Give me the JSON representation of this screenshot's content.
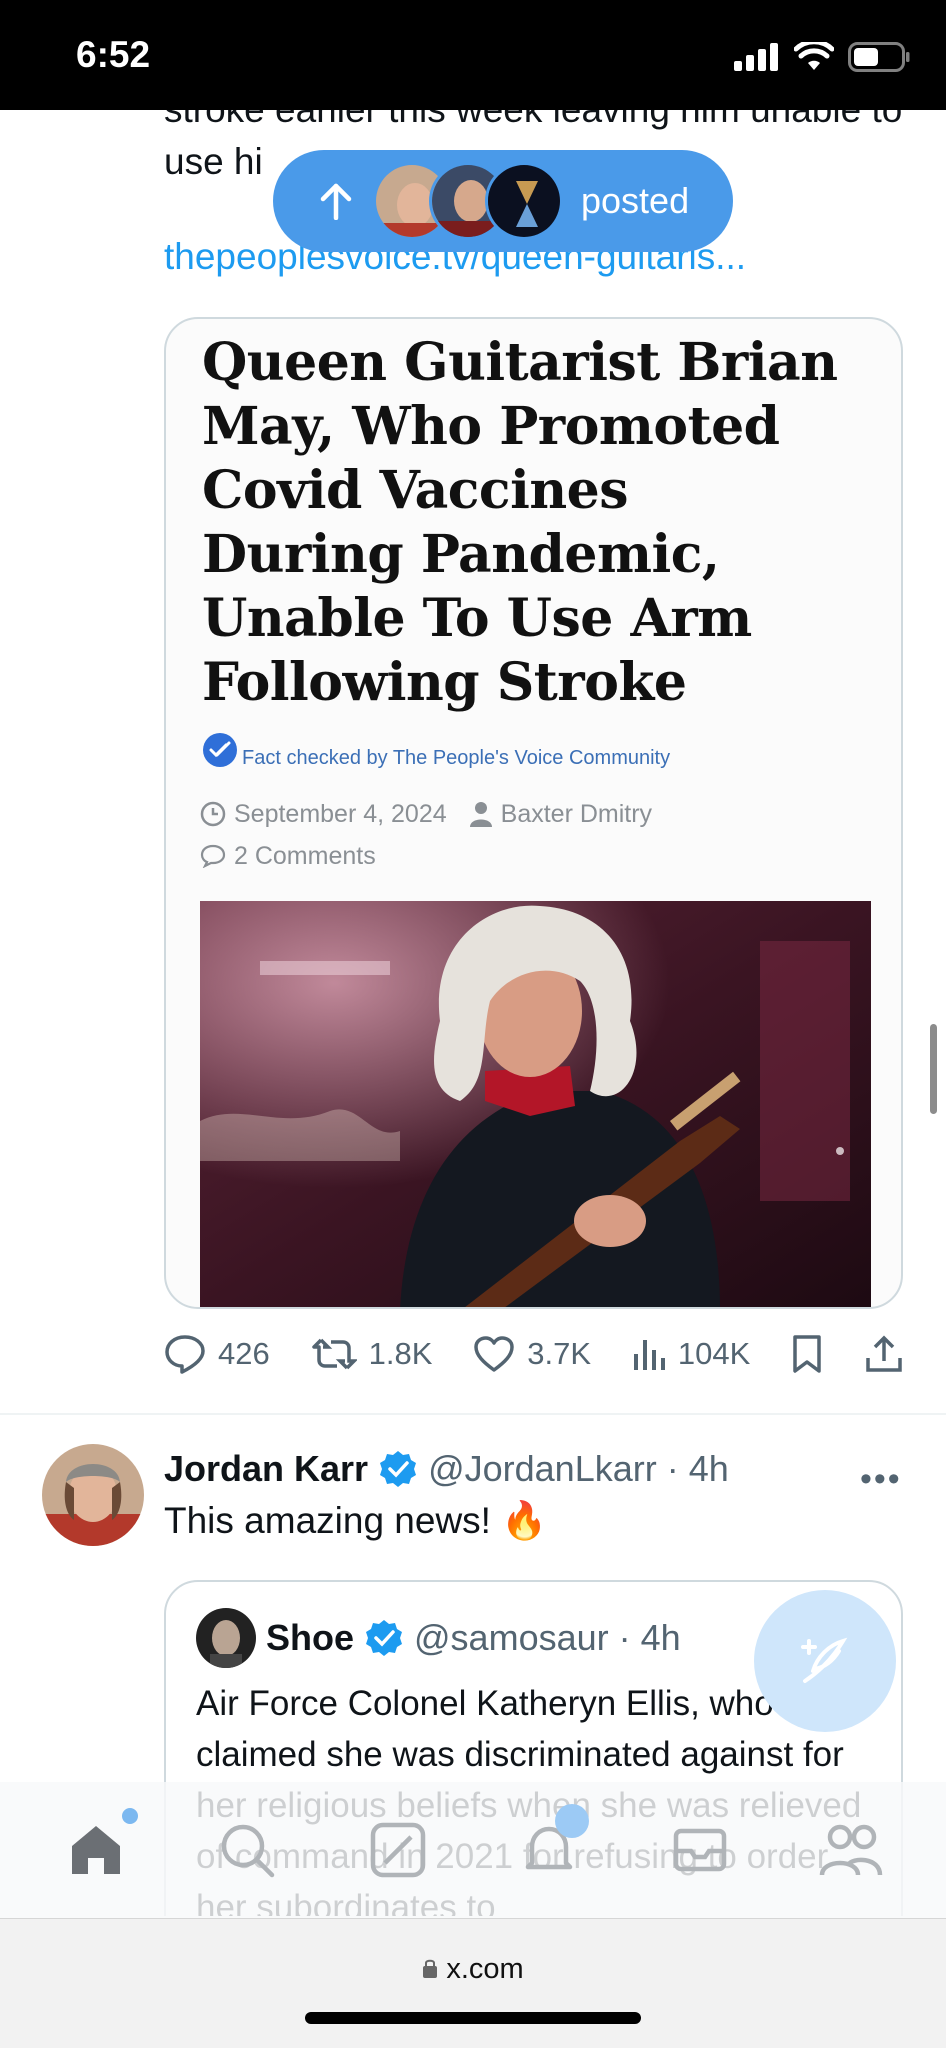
{
  "status_bar": {
    "time": "6:52"
  },
  "feed": {
    "top_tweet": {
      "text_partial": "stroke earlier this week leaving him unable to use hi",
      "link": "thepeoplesvoice.tv/queen-guitaris...",
      "card": {
        "headline": "Queen Guitarist Brian May, Who Promoted Covid Vaccines During Pandemic, Unable To Use Arm Following Stroke",
        "fact_check": "Fact checked by The People's Voice Community",
        "date": "September 4, 2024",
        "author": "Baxter Dmitry",
        "comments": "2 Comments"
      },
      "stats": {
        "replies": "426",
        "reposts": "1.8K",
        "likes": "3.7K",
        "views": "104K"
      }
    },
    "second_tweet": {
      "name": "Jordan Karr",
      "handle": "@JordanLkarr",
      "time": "· 4h",
      "text": "This amazing news! 🔥",
      "quote": {
        "name": "Shoe",
        "handle": "@samosaur",
        "time": "· 4h",
        "text": "Air Force Colonel Katheryn Ellis, who claimed she was discriminated against for her religious beliefs when she was relieved of command in 2021 for refusing to order her subordinates to"
      }
    }
  },
  "new_posts_pill": {
    "label": "posted"
  },
  "browser": {
    "url": "x.com"
  },
  "colors": {
    "accent": "#1d9bf0",
    "verified": "#1d9bf0",
    "pill": "#4a9ae9"
  }
}
